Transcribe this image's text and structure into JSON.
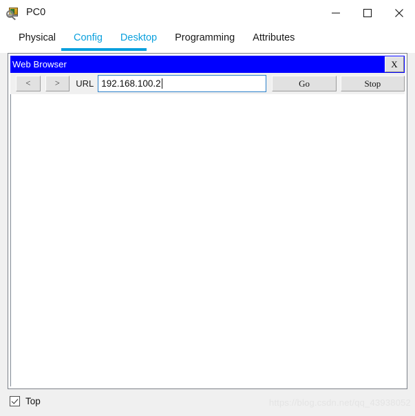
{
  "window": {
    "title": "PC0",
    "icon": "pc-inspect-icon",
    "controls": [
      {
        "name": "minimize-button",
        "glyph": "minimize-icon"
      },
      {
        "name": "maximize-button",
        "glyph": "maximize-icon"
      },
      {
        "name": "close-button",
        "glyph": "close-icon"
      }
    ]
  },
  "tabs": [
    {
      "label": "Physical",
      "active": false
    },
    {
      "label": "Config",
      "active": true
    },
    {
      "label": "Desktop",
      "active": true
    },
    {
      "label": "Programming",
      "active": false
    },
    {
      "label": "Attributes",
      "active": false
    }
  ],
  "browser": {
    "title": "Web Browser",
    "close_label": "X",
    "back_label": "<",
    "forward_label": ">",
    "url_label": "URL",
    "url_value": "192.168.100.2",
    "url_placeholder": "",
    "go_label": "Go",
    "stop_label": "Stop",
    "page_content": ""
  },
  "bottom": {
    "top_checkbox_label": "Top",
    "top_checkbox_checked": true
  },
  "watermark": "https://blog.csdn.net/qq_43938052",
  "colors": {
    "accent_tab": "#0aa0dd",
    "browser_titlebar": "#0000ff",
    "url_border": "#2a7fc9",
    "window_chrome": "#f0f0f0"
  }
}
